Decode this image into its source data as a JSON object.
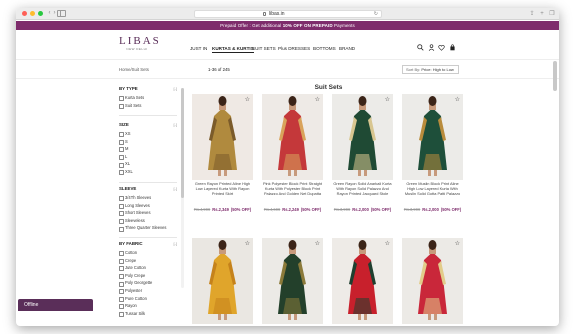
{
  "browser": {
    "url": "libas.in"
  },
  "promo": {
    "prefix": "Prepaid Offer : Get additional",
    "highlight": "10% OFF ON PREPAID",
    "suffix": "Payments"
  },
  "logo": {
    "main": "LIBAS",
    "sub": "NEW DELHI"
  },
  "menu": [
    "JUST IN",
    "KURTAS & KURTIS",
    "SUIT SETS",
    "Plus DRESSES",
    "BOTTOMS",
    "BRAND"
  ],
  "breadcrumb": "Home/Suit Sets",
  "result_count": "1-36 of 245",
  "sort": {
    "label": "Sort By:",
    "value": "Price: High to Low"
  },
  "page_title": "Suit Sets",
  "filters": {
    "clear_label": "[-]",
    "by_type": {
      "title": "BY TYPE",
      "items": [
        "Kurta Sets",
        "Suit Sets"
      ]
    },
    "size": {
      "title": "SIZE",
      "items": [
        "XS",
        "S",
        "M",
        "L",
        "XL",
        "XXL"
      ]
    },
    "sleeve": {
      "title": "SLEEVE",
      "items": [
        "3/4Th Sleeves",
        "Long Sleeves",
        "Short Sleeves",
        "Sleeveless",
        "Three Quarter Sleeves"
      ]
    },
    "fabric": {
      "title": "BY FABRIC",
      "items": [
        "Cotton",
        "Crepe",
        "Jute Cotton",
        "Poly Crepe",
        "Poly Georgette",
        "Polyester",
        "Pure Cotton",
        "Rayon",
        "Tussar Silk"
      ]
    }
  },
  "products": [
    {
      "name": "Green Rayon Printed Aline High Low Layered Kurta With Rayon Printed Skirt",
      "old_price": "Rs.4,999",
      "price": "Rs.2,349",
      "off": "(50% OFF)",
      "colors": {
        "bg": "#efe9e4",
        "dress": "#b08a3e",
        "accent": "#7b5b2a"
      }
    },
    {
      "name": "Pink Polyester Block Print Straight Kurta With Polyester Block Print Palazzo And Golden Net Dupatta",
      "old_price": "Rs.4,699",
      "price": "Rs.2,249",
      "off": "(50% OFF)",
      "colors": {
        "bg": "#eeeae6",
        "dress": "#c4383a",
        "accent": "#d9a35b"
      }
    },
    {
      "name": "Green Rayon Solid Anarkali Kurta With Rayon Solid Palazzo And Rayon Printed Jacquard Stole",
      "old_price": "Rs.3,999",
      "price": "Rs.2,000",
      "off": "(50% OFF)",
      "colors": {
        "bg": "#ecebe8",
        "dress": "#1f4a34",
        "accent": "#d8c690"
      }
    },
    {
      "name": "Green Muslin Block Print Aline High Low Layered Kurta With Muslin Solid Gotta Patti Palazzo",
      "old_price": "Rs.3,999",
      "price": "Rs.2,000",
      "off": "(50% OFF)",
      "colors": {
        "bg": "#ecebe8",
        "dress": "#1e4f3a",
        "accent": "#b98c3c"
      }
    },
    {
      "colors": {
        "bg": "#eae7e2",
        "dress": "#e0a52b",
        "accent": "#c5821b"
      }
    },
    {
      "colors": {
        "bg": "#eceae6",
        "dress": "#23402b",
        "accent": "#8b7a3a"
      }
    },
    {
      "colors": {
        "bg": "#eeebe7",
        "dress": "#c8202c",
        "accent": "#1f3f2f"
      }
    },
    {
      "colors": {
        "bg": "#eceae6",
        "dress": "#c9273a",
        "accent": "#e2cc8a"
      }
    }
  ],
  "offline_chat": "Offline"
}
